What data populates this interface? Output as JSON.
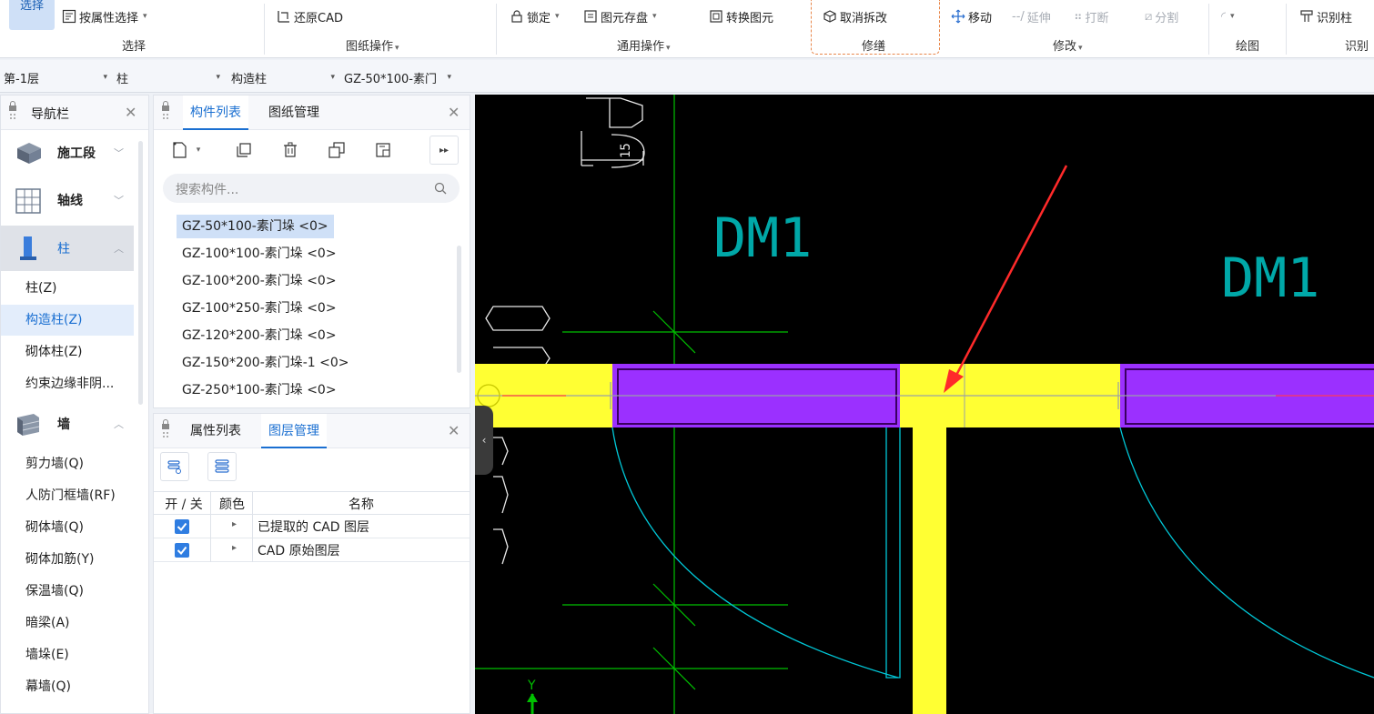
{
  "toolbar": {
    "select_label": "选择",
    "attr_select_label": "按属性选择",
    "select_group": "选择",
    "restore_cad_label": "还原CAD",
    "drawing_ops_group": "图纸操作",
    "lock_label": "锁定",
    "store_label": "图元存盘",
    "convert_label": "转换图元",
    "common_ops_group": "通用操作",
    "cancel_split_label": "取消拆改",
    "fix_group": "修缮",
    "move_label": "移动",
    "extend_label": "延伸",
    "break_label": "打断",
    "split_label": "分割",
    "modify_group": "修改",
    "draw_group": "绘图",
    "identify_column_label": "识别柱",
    "identify_group": "识别"
  },
  "filterbar": {
    "floor": "第-1层",
    "category": "柱",
    "type": "构造柱",
    "component": "GZ-50*100-素门"
  },
  "nav": {
    "title": "导航栏",
    "categories": [
      {
        "label": "施工段"
      },
      {
        "label": "轴线"
      },
      {
        "label": "柱"
      },
      {
        "label": "墙"
      }
    ],
    "column_items": [
      "柱(Z)",
      "构造柱(Z)",
      "砌体柱(Z)",
      "约束边缘非阴..."
    ],
    "wall_items": [
      "剪力墙(Q)",
      "人防门框墙(RF)",
      "砌体墙(Q)",
      "砌体加筋(Y)",
      "保温墙(Q)",
      "暗梁(A)",
      "墙垛(E)",
      "幕墙(Q)"
    ]
  },
  "components": {
    "tab_list": "构件列表",
    "tab_drawings": "图纸管理",
    "search_placeholder": "搜索构件...",
    "items": [
      "GZ-50*100-素门垛 <0>",
      "GZ-100*100-素门垛 <0>",
      "GZ-100*200-素门垛 <0>",
      "GZ-100*250-素门垛 <0>",
      "GZ-120*200-素门垛 <0>",
      "GZ-150*200-素门垛-1 <0>",
      "GZ-250*100-素门垛 <0>"
    ]
  },
  "layers": {
    "tab_props": "属性列表",
    "tab_layers": "图层管理",
    "col_toggle": "开 / 关",
    "col_color": "颜色",
    "col_name": "名称",
    "rows": [
      "已提取的 CAD 图层",
      "CAD 原始图层"
    ]
  },
  "canvas": {
    "text_dm1_a": "DM1",
    "text_dm1_b": "DM1",
    "text_15": "15",
    "axis_y": "Y",
    "colors": {
      "bg": "#000000",
      "column": "#ffff33",
      "wall": "#9b30ff",
      "grid": "#00c000",
      "door": "#00bcd4",
      "arrow": "#ff2a2a"
    }
  }
}
